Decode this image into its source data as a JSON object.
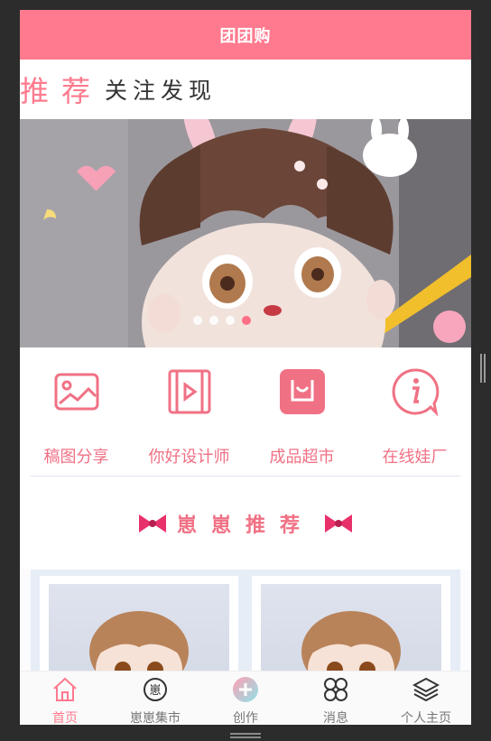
{
  "app": {
    "title": "团团购"
  },
  "tabs": {
    "active": "推荐",
    "others": "关注发现"
  },
  "banner": {
    "slides": 4,
    "active_index": 3
  },
  "menu": [
    {
      "label": "稿图分享",
      "icon": "image-icon"
    },
    {
      "label": "你好设计师",
      "icon": "video-icon"
    },
    {
      "label": "成品超市",
      "icon": "shopping-bag-icon"
    },
    {
      "label": "在线娃厂",
      "icon": "info-icon"
    }
  ],
  "section": {
    "title": "崽崽推荐"
  },
  "bottom_nav": [
    {
      "label": "首页",
      "icon": "home-icon",
      "active": true,
      "icon_text": ""
    },
    {
      "label": "崽崽集市",
      "icon": "market-icon",
      "active": false,
      "icon_text": "崽"
    },
    {
      "label": "创作",
      "icon": "create-plus-icon",
      "active": false,
      "icon_text": ""
    },
    {
      "label": "消息",
      "icon": "message-icon",
      "active": false,
      "icon_text": ""
    },
    {
      "label": "个人主页",
      "icon": "layers-icon",
      "active": false,
      "icon_text": ""
    }
  ],
  "colors": {
    "brand": "#ff7a8e",
    "accent_text": "#f07184"
  }
}
